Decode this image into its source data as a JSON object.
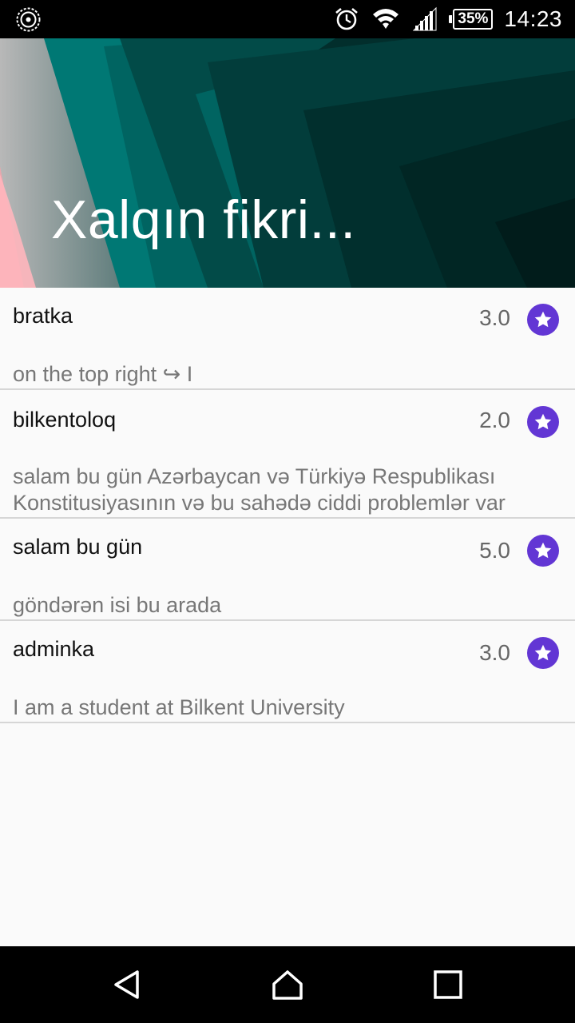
{
  "status_bar": {
    "left_icon": "app-notification-icon",
    "icons": [
      "alarm-icon",
      "wifi-icon",
      "signal-icon"
    ],
    "battery": "35%",
    "time": "14:23"
  },
  "header": {
    "title": "Xalqın fikri..."
  },
  "reviews": [
    {
      "name": "bratka",
      "rating": "3.0",
      "comment": "on the top right ↪ I"
    },
    {
      "name": "bilkentoloq",
      "rating": "2.0",
      "comment": "salam bu gün Azərbaycan və Türkiyə Respublikası Konstitusiyasının və bu sahədə ciddi problemlər var"
    },
    {
      "name": "salam bu gün",
      "rating": "5.0",
      "comment": "göndərən isi bu arada"
    },
    {
      "name": "adminka",
      "rating": "3.0",
      "comment": "I am a student at Bilkent University"
    }
  ],
  "colors": {
    "accent": "#6236d4",
    "header_dark": "#022e2c",
    "header_teal": "#007b78"
  },
  "nav_bar": {
    "icons": [
      "back-icon",
      "home-icon",
      "recents-icon"
    ]
  }
}
